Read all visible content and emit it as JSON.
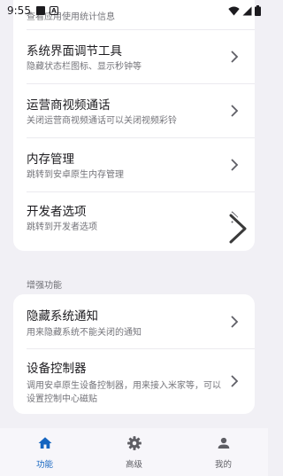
{
  "status_bar": {
    "time": "9:55"
  },
  "card1": {
    "partial_desc": "查看应用使用统计信息",
    "items": [
      {
        "title": "系统界面调节工具",
        "desc": "隐藏状态栏图标、显示秒钟等"
      },
      {
        "title": "运营商视频通话",
        "desc": "关闭运营商视频通话可以关闭视频彩铃"
      },
      {
        "title": "内存管理",
        "desc": "跳转到安卓原生内存管理"
      },
      {
        "title": "开发者选项",
        "desc": "跳转到开发者选项"
      }
    ]
  },
  "section2": {
    "label": "增强功能",
    "items": [
      {
        "title": "隐藏系统通知",
        "desc": "用来隐藏系统不能关闭的通知"
      },
      {
        "title": "设备控制器",
        "desc": "调用安卓原生设备控制器，用来接入米家等，可以设置控制中心磁贴"
      }
    ]
  },
  "bottom_nav": {
    "items": [
      {
        "label": "功能",
        "icon": "home-icon",
        "active": true
      },
      {
        "label": "高级",
        "icon": "gear-icon",
        "active": false
      },
      {
        "label": "我的",
        "icon": "person-icon",
        "active": false
      }
    ]
  },
  "colors": {
    "accent": "#1565c0",
    "background": "#f1f0f5",
    "card": "#ffffff"
  }
}
